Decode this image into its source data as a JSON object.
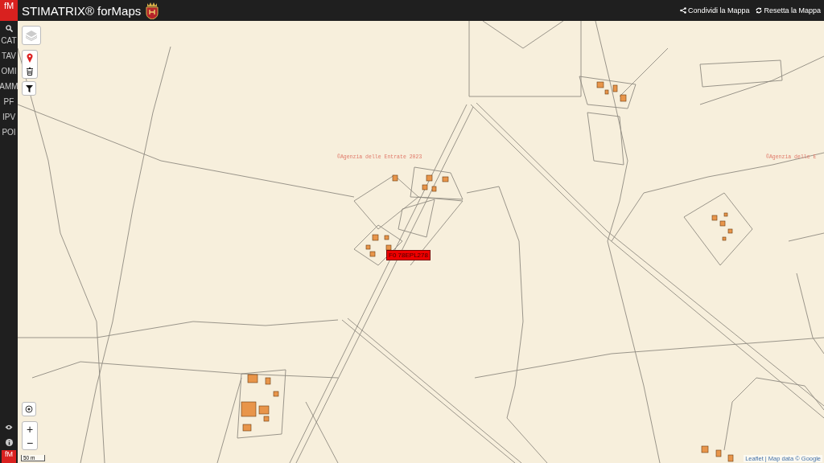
{
  "header": {
    "logo": "fM",
    "title": "STIMATRIX® forMaps",
    "actions": [
      {
        "kind": "share",
        "label": "Condividi la Mappa"
      },
      {
        "kind": "reset",
        "label": "Resetta la Mappa"
      }
    ]
  },
  "sidebar": {
    "items": [
      "CAT",
      "TAV",
      "OMI",
      "AMM",
      "PF",
      "IPV",
      "POI"
    ],
    "logo": "fM"
  },
  "map": {
    "copyright_labels": [
      "©Agenzia delle Entrate 2023",
      "©Agenzia delle E"
    ],
    "parcel_label": "F0 78EPL278",
    "zoom_in": "+",
    "zoom_out": "−",
    "scale": "50 m",
    "attribution": "Leaflet | Map data © Google"
  }
}
